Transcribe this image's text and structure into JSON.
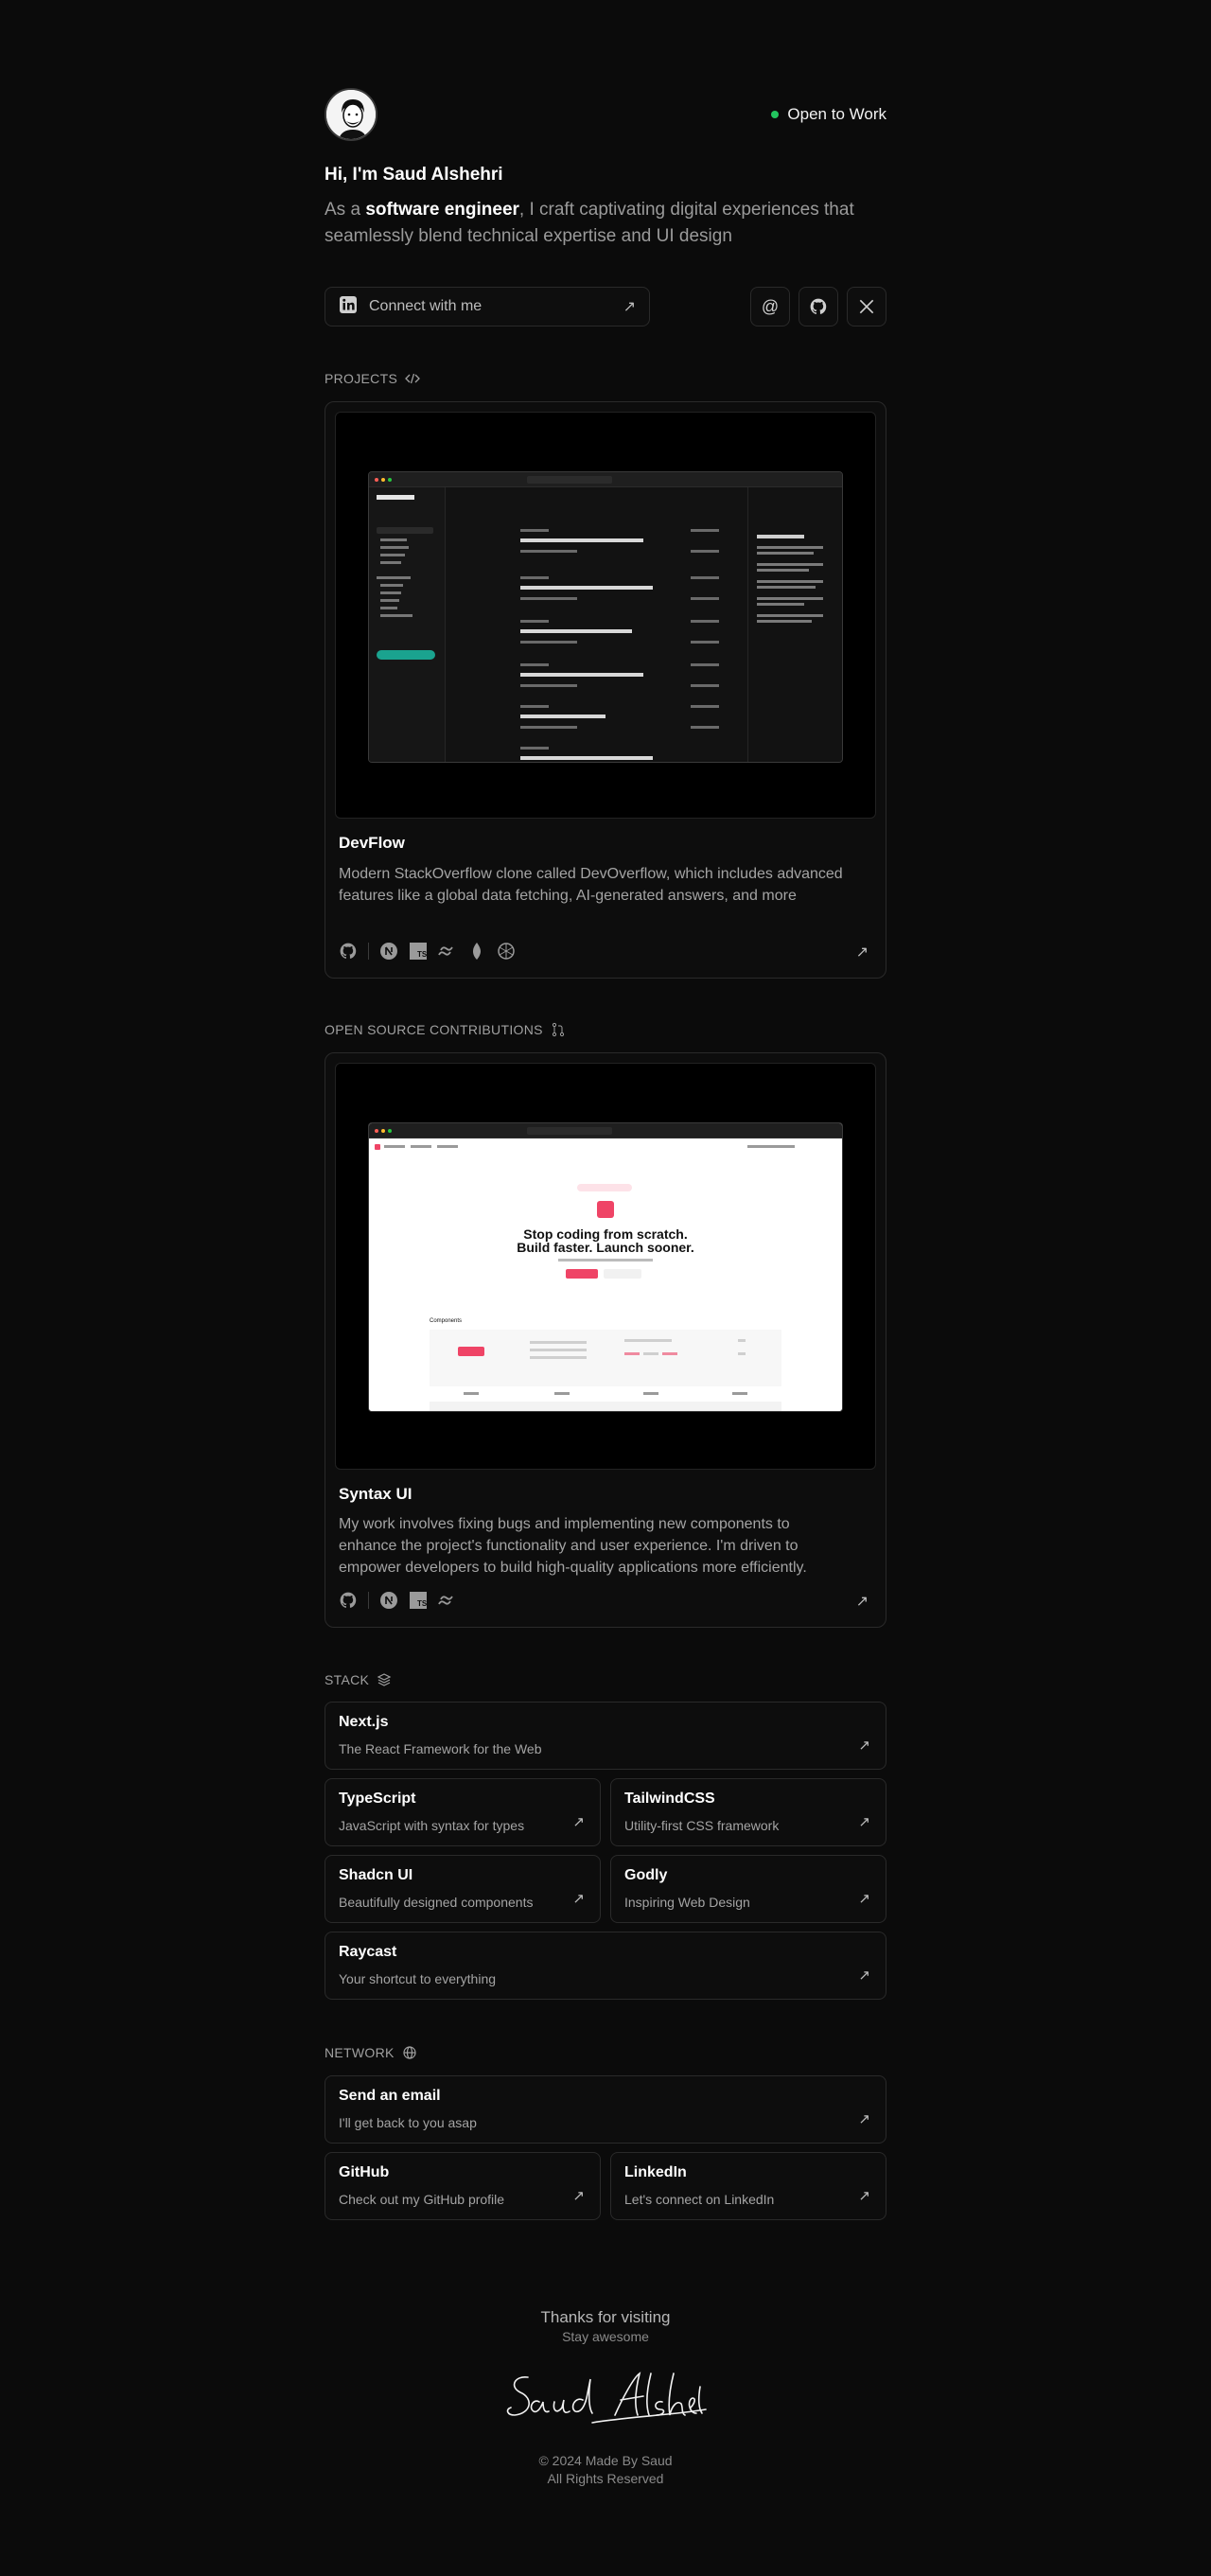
{
  "header": {
    "status": "Open to Work",
    "greeting": "Hi, I'm Saud Alshehri",
    "bio_prefix": "As a ",
    "bio_role": "software engineer",
    "bio_suffix": ", I craft captivating digital experiences that seamlessly blend technical expertise and UI design"
  },
  "connect": {
    "label": "Connect with me",
    "links": [
      "email-icon",
      "github-icon",
      "x-icon"
    ]
  },
  "projects": {
    "label": "PROJECTS",
    "items": [
      {
        "title": "DevFlow",
        "description": "Modern StackOverflow clone called DevOverflow, which includes advanced features like a global data fetching, AI-generated answers, and more",
        "tech": [
          "github-icon",
          "nextjs-icon",
          "typescript-icon",
          "tailwind-icon",
          "mongodb-icon",
          "openai-icon"
        ]
      }
    ]
  },
  "open_source": {
    "label": "OPEN SOURCE CONTRIBUTIONS",
    "items": [
      {
        "title": "Syntax UI",
        "description": "My work involves fixing bugs and implementing new components to enhance the project's functionality and user experience. I'm driven to empower developers to build high-quality applications more efficiently.",
        "tech": [
          "github-icon",
          "nextjs-icon",
          "typescript-icon",
          "tailwind-icon"
        ],
        "preview": {
          "headline1": "Stop coding from scratch.",
          "headline2": "Build faster. Launch sooner.",
          "section": "Components"
        }
      }
    ]
  },
  "stack": {
    "label": "STACK",
    "items": [
      {
        "title": "Next.js",
        "subtitle": "The React Framework for the Web"
      },
      {
        "title": "TypeScript",
        "subtitle": "JavaScript with syntax for types"
      },
      {
        "title": "TailwindCSS",
        "subtitle": "Utility-first CSS framework"
      },
      {
        "title": "Shadcn UI",
        "subtitle": "Beautifully designed components"
      },
      {
        "title": "Godly",
        "subtitle": "Inspiring Web Design"
      },
      {
        "title": "Raycast",
        "subtitle": "Your shortcut to everything"
      }
    ]
  },
  "network": {
    "label": "NETWORK",
    "items": [
      {
        "title": "Send an email",
        "subtitle": "I'll get back to you asap"
      },
      {
        "title": "GitHub",
        "subtitle": "Check out my GitHub profile"
      },
      {
        "title": "LinkedIn",
        "subtitle": "Let's connect on LinkedIn"
      }
    ]
  },
  "footer": {
    "thanks": "Thanks for visiting",
    "stay": "Stay awesome",
    "copyright": "© 2024 Made By Saud",
    "rights": "All Rights Reserved"
  },
  "colors": {
    "background": "#0b0b0b",
    "status_dot": "#22c55e",
    "card_border": "#2a2a2a",
    "syntax_accent": "#ef4466",
    "devflow_accent": "#1aa38f"
  }
}
